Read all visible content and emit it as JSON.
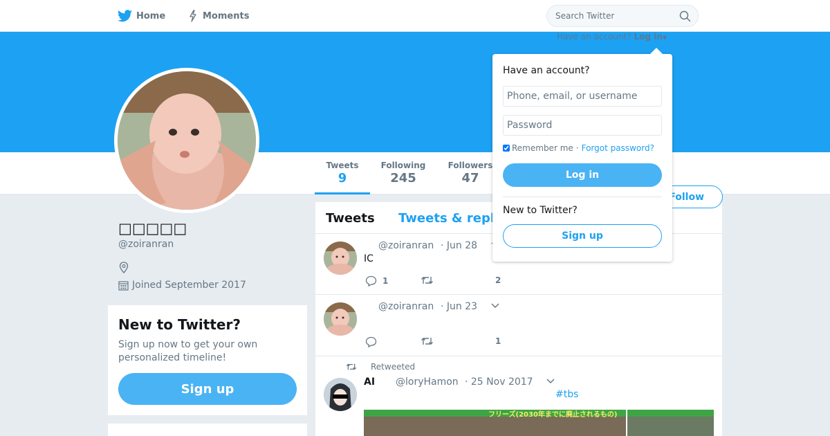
{
  "nav": {
    "home_label": "Home",
    "moments_label": "Moments",
    "search_placeholder": "Search Twitter"
  },
  "header": {
    "have_account_prompt": "Have an account?",
    "login_link": "Log in"
  },
  "profile": {
    "name": "□□□□□",
    "handle": "@zoiranran",
    "joined": "Joined September 2017",
    "follow_label": "Follow"
  },
  "stats": [
    {
      "label": "Tweets",
      "value": "9"
    },
    {
      "label": "Following",
      "value": "245"
    },
    {
      "label": "Followers",
      "value": "47"
    }
  ],
  "signup_card": {
    "title": "New to Twitter?",
    "text": "Sign up now to get your own personalized timeline!",
    "button": "Sign up"
  },
  "timeline": {
    "tabs": [
      "Tweets",
      "Tweets & repl"
    ],
    "tweets": [
      {
        "handle": "@zoiranran",
        "date": "· Jun 28",
        "text": "IC",
        "replies": "1",
        "retweets": "",
        "likes": "2"
      },
      {
        "handle": "@zoiranran",
        "date": "· Jun 23",
        "text": "",
        "replies": "",
        "retweets": "",
        "likes": "1"
      },
      {
        "retweeted_label": "Retweeted",
        "name": "AI",
        "handle": "@loryHamon",
        "date": "· 25 Nov 2017",
        "hashtag": "#tbs",
        "media_caption": "フリーズ(2030年までに廃止されるもの)"
      }
    ]
  },
  "login_dropdown": {
    "title": "Have an account?",
    "username_placeholder": "Phone, email, or username",
    "password_placeholder": "Password",
    "remember_label": "Remember me",
    "separator": "·",
    "forgot_label": "Forgot password?",
    "login_button": "Log in",
    "new_label": "New to Twitter?",
    "signup_button": "Sign up"
  },
  "colors": {
    "brand_blue": "#1da1f2",
    "button_blue": "#4ab3f4",
    "page_bg": "#e6ecf0"
  }
}
